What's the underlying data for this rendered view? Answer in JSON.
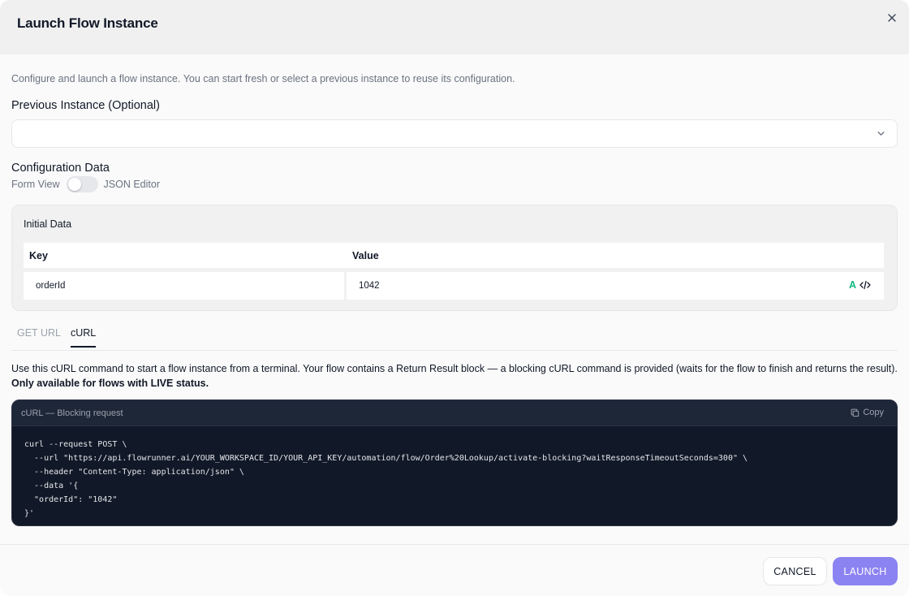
{
  "dialog": {
    "title": "Launch Flow Instance",
    "close_icon": "close-icon"
  },
  "intro": "Configure and launch a flow instance. You can start fresh or select a previous instance to reuse its configuration.",
  "previous_instance": {
    "label": "Previous Instance (Optional)",
    "value": ""
  },
  "configuration": {
    "label": "Configuration Data",
    "toggle_left": "Form View",
    "toggle_right": "JSON Editor",
    "json_editor_enabled": false
  },
  "initial_data": {
    "title": "Initial Data",
    "columns": [
      "Key",
      "Value"
    ],
    "rows": [
      {
        "key": "orderId",
        "value": "1042"
      }
    ],
    "value_icons": [
      "text-type-icon",
      "code-icon"
    ]
  },
  "tabs": [
    {
      "label": "GET URL",
      "active": false
    },
    {
      "label": "cURL",
      "active": true
    }
  ],
  "description": {
    "text": "Use this cURL command to start a flow instance from a terminal. Your flow contains a Return Result block — a blocking cURL command is provided (waits for the flow to finish and returns the result).",
    "bold": "Only available for flows with LIVE status."
  },
  "code": {
    "title": "cURL — Blocking request",
    "copy_label": "Copy",
    "lines": [
      "curl --request POST \\",
      "  --url \"https://api.flowrunner.ai/YOUR_WORKSPACE_ID/YOUR_API_KEY/automation/flow/Order%20Lookup/activate-blocking?waitResponseTimeoutSeconds=300\" \\",
      "  --header \"Content-Type: application/json\" \\",
      "  --data '{",
      "  \"orderId\": \"1042\"",
      "}'"
    ]
  },
  "footer": {
    "cancel_label": "CANCEL",
    "launch_label": "LAUNCH"
  },
  "colors": {
    "accent": "#8b83f1",
    "code_bg": "#111827",
    "header_bg": "#f0f0f0",
    "type_icon": "#10b981"
  }
}
